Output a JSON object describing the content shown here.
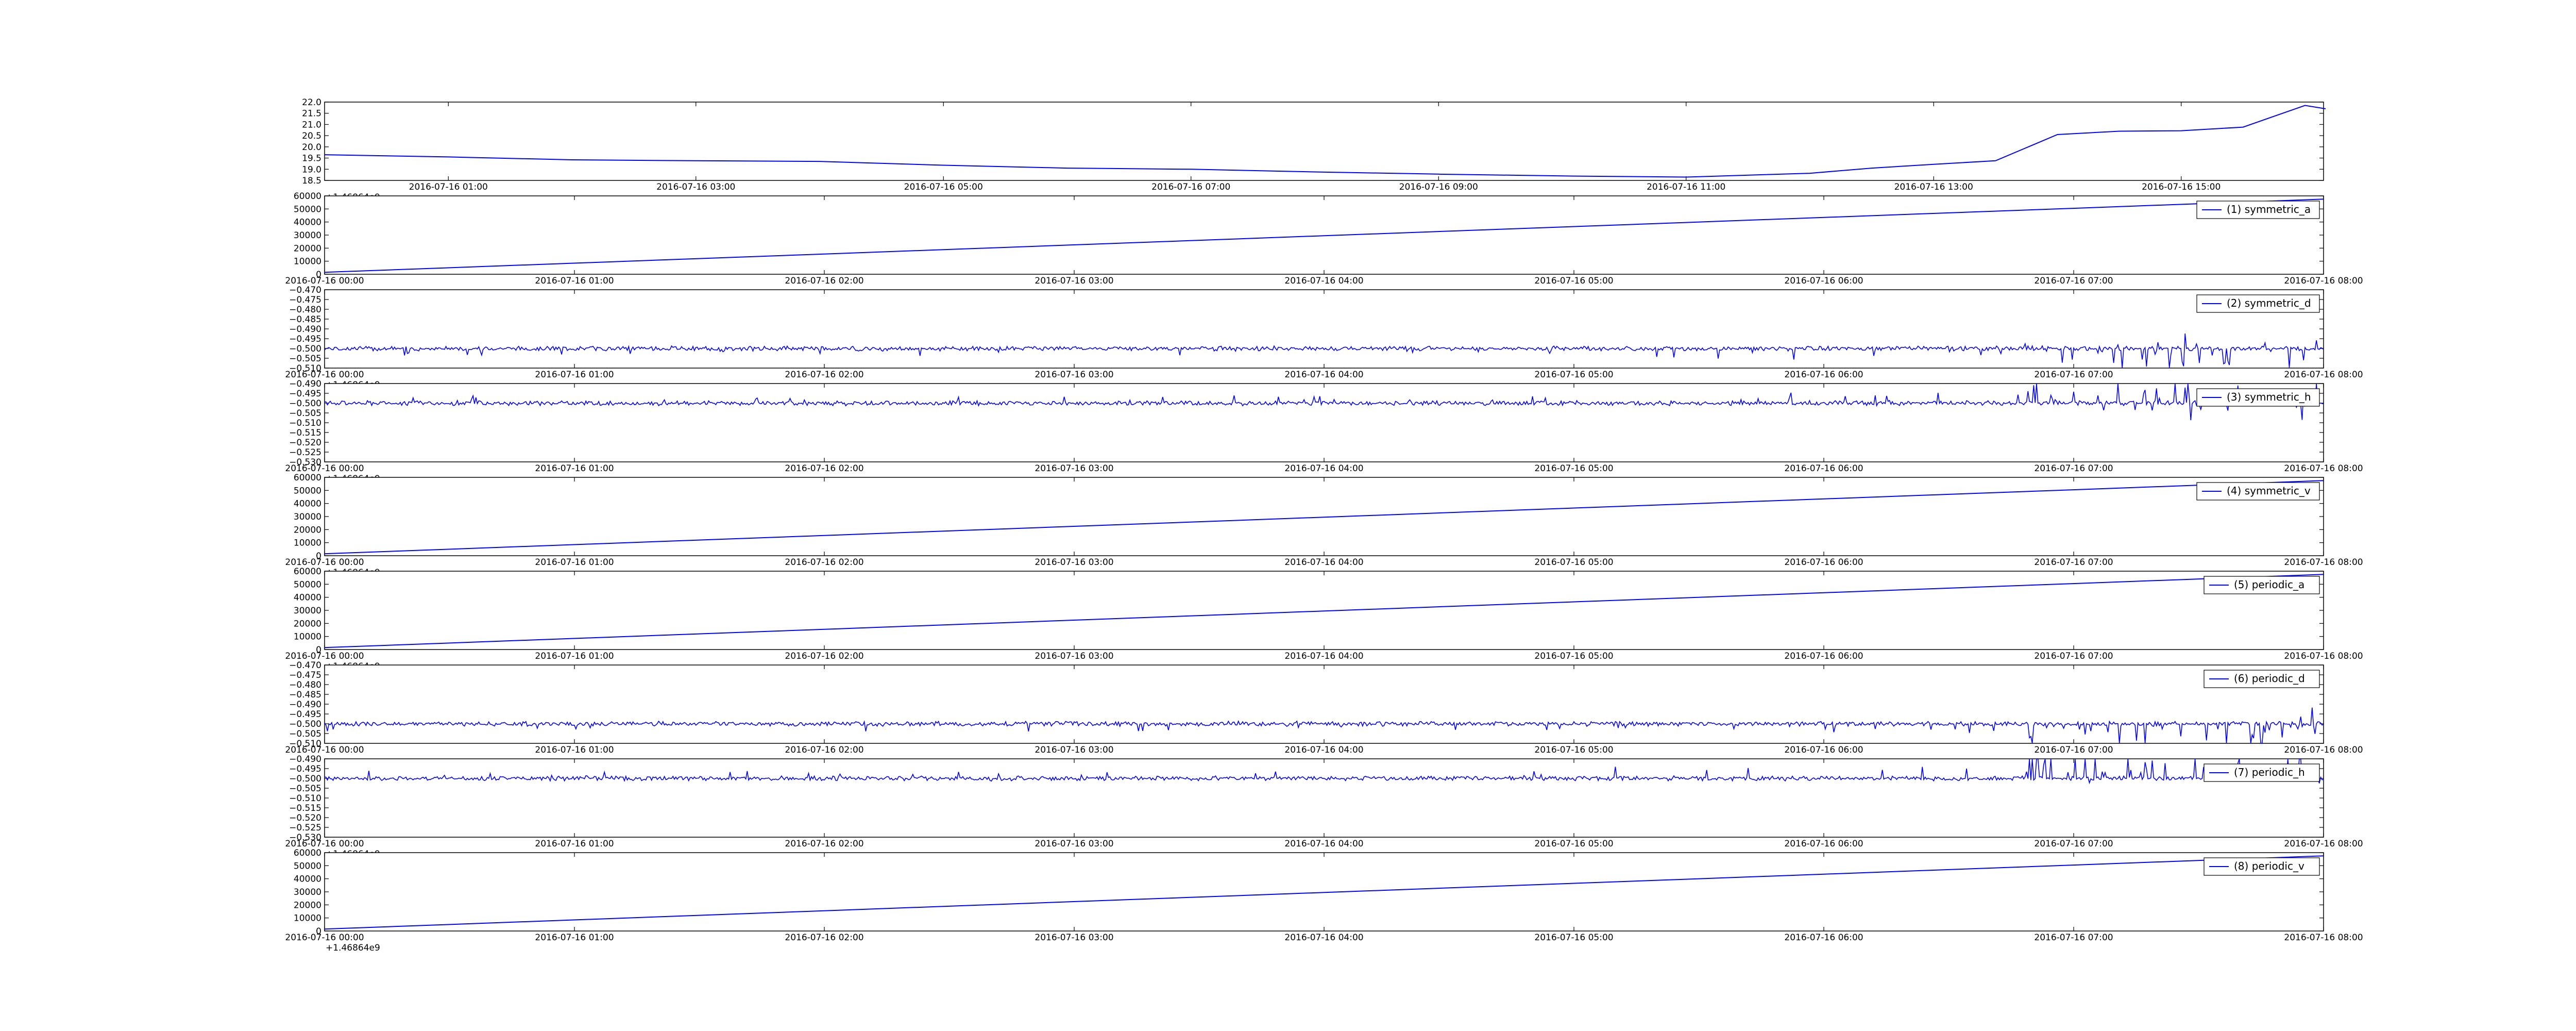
{
  "figure": {
    "background": "#ffffff",
    "line_color": "#0000ff"
  },
  "chart_data": [
    {
      "type": "line",
      "title": "",
      "offset_label": "+1.46864e9",
      "y_ticks": [
        "22.0",
        "21.5",
        "21.0",
        "20.5",
        "20.0",
        "19.5",
        "19.0",
        "18.5"
      ],
      "ylim": [
        18.5,
        22.0
      ],
      "x_ticks": [
        "2016-07-16 01:00",
        "2016-07-16 03:00",
        "2016-07-16 05:00",
        "2016-07-16 07:00",
        "2016-07-16 09:00",
        "2016-07-16 11:00",
        "2016-07-16 13:00",
        "2016-07-16 15:00"
      ],
      "x": [
        "2016-07-16 00:00",
        "2016-07-16 01:00",
        "2016-07-16 02:00",
        "2016-07-16 03:00",
        "2016-07-16 04:00",
        "2016-07-16 05:00",
        "2016-07-16 06:00",
        "2016-07-16 07:00",
        "2016-07-16 08:00",
        "2016-07-16 09:00",
        "2016-07-16 10:00",
        "2016-07-16 11:00",
        "2016-07-16 12:00",
        "2016-07-16 12:30",
        "2016-07-16 13:00",
        "2016-07-16 13:30",
        "2016-07-16 14:00",
        "2016-07-16 14:30",
        "2016-07-16 15:00",
        "2016-07-16 15:30",
        "2016-07-16 16:00",
        "2016-07-16 16:10"
      ],
      "series": [
        {
          "values": [
            19.65,
            19.55,
            19.42,
            19.38,
            19.35,
            19.18,
            19.05,
            19.0,
            18.88,
            18.78,
            18.7,
            18.65,
            18.82,
            19.05,
            19.22,
            19.38,
            20.55,
            20.7,
            20.72,
            20.88,
            21.85,
            21.7
          ]
        }
      ]
    },
    {
      "type": "line",
      "y_ticks": [
        "60000",
        "50000",
        "40000",
        "30000",
        "20000",
        "10000",
        "0"
      ],
      "ylim": [
        0,
        60000
      ],
      "x_ticks": [
        "2016-07-16 00:00",
        "2016-07-16 01:00",
        "2016-07-16 02:00",
        "2016-07-16 03:00",
        "2016-07-16 04:00",
        "2016-07-16 05:00",
        "2016-07-16 06:00",
        "2016-07-16 07:00",
        "2016-07-16 08:00"
      ],
      "x": [
        "2016-07-16 00:00",
        "2016-07-16 08:00"
      ],
      "series": [
        {
          "name": "(1) symmetric_a",
          "values": [
            1500,
            57500
          ]
        }
      ],
      "legend": "top-right"
    },
    {
      "type": "line",
      "y_ticks": [
        "−0.470",
        "−0.475",
        "−0.480",
        "−0.485",
        "−0.490",
        "−0.495",
        "−0.500",
        "−0.505",
        "−0.510"
      ],
      "ylim": [
        -0.51,
        -0.47
      ],
      "offset_label": "+1.46864e9",
      "x_ticks": [
        "2016-07-16 00:00",
        "2016-07-16 01:00",
        "2016-07-16 02:00",
        "2016-07-16 03:00",
        "2016-07-16 04:00",
        "2016-07-16 05:00",
        "2016-07-16 06:00",
        "2016-07-16 07:00",
        "2016-07-16 08:00"
      ],
      "baseline": -0.5,
      "series": [
        {
          "name": "(2) symmetric_d"
        }
      ],
      "legend": "top-right"
    },
    {
      "type": "line",
      "y_ticks": [
        "−0.490",
        "−0.495",
        "−0.500",
        "−0.505",
        "−0.510",
        "−0.515",
        "−0.520",
        "−0.525",
        "−0.530"
      ],
      "ylim": [
        -0.53,
        -0.49
      ],
      "offset_label": "+1.46864e9",
      "x_ticks": [
        "2016-07-16 00:00",
        "2016-07-16 01:00",
        "2016-07-16 02:00",
        "2016-07-16 03:00",
        "2016-07-16 04:00",
        "2016-07-16 05:00",
        "2016-07-16 06:00",
        "2016-07-16 07:00",
        "2016-07-16 08:00"
      ],
      "baseline": -0.5,
      "series": [
        {
          "name": "(3) symmetric_h"
        }
      ],
      "legend": "top-right"
    },
    {
      "type": "line",
      "y_ticks": [
        "60000",
        "50000",
        "40000",
        "30000",
        "20000",
        "10000",
        "0"
      ],
      "ylim": [
        0,
        60000
      ],
      "offset_label": "+1.46864e9",
      "x_ticks": [
        "2016-07-16 00:00",
        "2016-07-16 01:00",
        "2016-07-16 02:00",
        "2016-07-16 03:00",
        "2016-07-16 04:00",
        "2016-07-16 05:00",
        "2016-07-16 06:00",
        "2016-07-16 07:00",
        "2016-07-16 08:00"
      ],
      "x": [
        "2016-07-16 00:00",
        "2016-07-16 08:00"
      ],
      "series": [
        {
          "name": "(4) symmetric_v",
          "values": [
            1500,
            57500
          ]
        }
      ],
      "legend": "top-right"
    },
    {
      "type": "line",
      "y_ticks": [
        "60000",
        "50000",
        "40000",
        "30000",
        "20000",
        "10000",
        "0"
      ],
      "ylim": [
        0,
        60000
      ],
      "offset_label": "+1.46864e9",
      "x_ticks": [
        "2016-07-16 00:00",
        "2016-07-16 01:00",
        "2016-07-16 02:00",
        "2016-07-16 03:00",
        "2016-07-16 04:00",
        "2016-07-16 05:00",
        "2016-07-16 06:00",
        "2016-07-16 07:00",
        "2016-07-16 08:00"
      ],
      "x": [
        "2016-07-16 00:00",
        "2016-07-16 08:00"
      ],
      "series": [
        {
          "name": "(5) periodic_a",
          "values": [
            1500,
            57500
          ]
        }
      ],
      "legend": "top-right"
    },
    {
      "type": "line",
      "y_ticks": [
        "−0.470",
        "−0.475",
        "−0.480",
        "−0.485",
        "−0.490",
        "−0.495",
        "−0.500",
        "−0.505",
        "−0.510"
      ],
      "ylim": [
        -0.51,
        -0.47
      ],
      "x_ticks": [
        "2016-07-16 00:00",
        "2016-07-16 01:00",
        "2016-07-16 02:00",
        "2016-07-16 03:00",
        "2016-07-16 04:00",
        "2016-07-16 05:00",
        "2016-07-16 06:00",
        "2016-07-16 07:00",
        "2016-07-16 08:00"
      ],
      "baseline": -0.5,
      "series": [
        {
          "name": "(6) periodic_d"
        }
      ],
      "legend": "top-right"
    },
    {
      "type": "line",
      "y_ticks": [
        "−0.490",
        "−0.495",
        "−0.500",
        "−0.505",
        "−0.510",
        "−0.515",
        "−0.520",
        "−0.525",
        "−0.530"
      ],
      "ylim": [
        -0.53,
        -0.49
      ],
      "offset_label": "+1.46864e9",
      "x_ticks": [
        "2016-07-16 00:00",
        "2016-07-16 01:00",
        "2016-07-16 02:00",
        "2016-07-16 03:00",
        "2016-07-16 04:00",
        "2016-07-16 05:00",
        "2016-07-16 06:00",
        "2016-07-16 07:00",
        "2016-07-16 08:00"
      ],
      "baseline": -0.5,
      "series": [
        {
          "name": "(7) periodic_h"
        }
      ],
      "legend": "top-right"
    },
    {
      "type": "line",
      "y_ticks": [
        "60000",
        "50000",
        "40000",
        "30000",
        "20000",
        "10000",
        "0"
      ],
      "ylim": [
        0,
        60000
      ],
      "offset_label": "+1.46864e9",
      "x_ticks": [
        "2016-07-16 00:00",
        "2016-07-16 01:00",
        "2016-07-16 02:00",
        "2016-07-16 03:00",
        "2016-07-16 04:00",
        "2016-07-16 05:00",
        "2016-07-16 06:00",
        "2016-07-16 07:00",
        "2016-07-16 08:00"
      ],
      "x": [
        "2016-07-16 00:00",
        "2016-07-16 08:00"
      ],
      "series": [
        {
          "name": "(8) periodic_v",
          "values": [
            1500,
            57500
          ]
        }
      ],
      "legend": "top-right"
    }
  ]
}
